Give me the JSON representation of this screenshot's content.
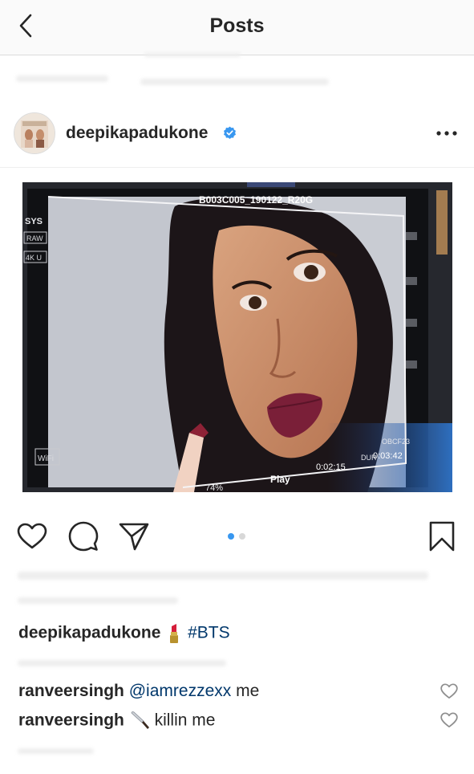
{
  "header": {
    "title": "Posts"
  },
  "post": {
    "username": "deepikapadukone",
    "photo": {
      "monitor": {
        "clip_name": "B003C005_190122_R20G",
        "sys_label": "SYS",
        "raw_label": "RAW",
        "res_label": "4K U",
        "wifi_label": "WiFi",
        "play_label": "Play",
        "timecode": "0:02:15",
        "dur_label": "DUR",
        "duration": "0:03:42",
        "cam_label": "OBCF23",
        "percent": "74%"
      }
    },
    "carousel": {
      "count": 2,
      "active_index": 0,
      "active_color": "#3897f0",
      "inactive_color": "#d8d8d8"
    },
    "caption": {
      "username": "deepikapadukone",
      "emoji": "lipstick",
      "hashtag": "#BTS"
    },
    "comments": [
      {
        "username": "ranveersingh",
        "mention": "@iamrezzexx",
        "text": " me"
      },
      {
        "username": "ranveersingh",
        "emoji": "knife",
        "text": " killin me"
      }
    ]
  },
  "colors": {
    "verified": "#3897f0",
    "link": "#00376b",
    "text": "#262626"
  }
}
